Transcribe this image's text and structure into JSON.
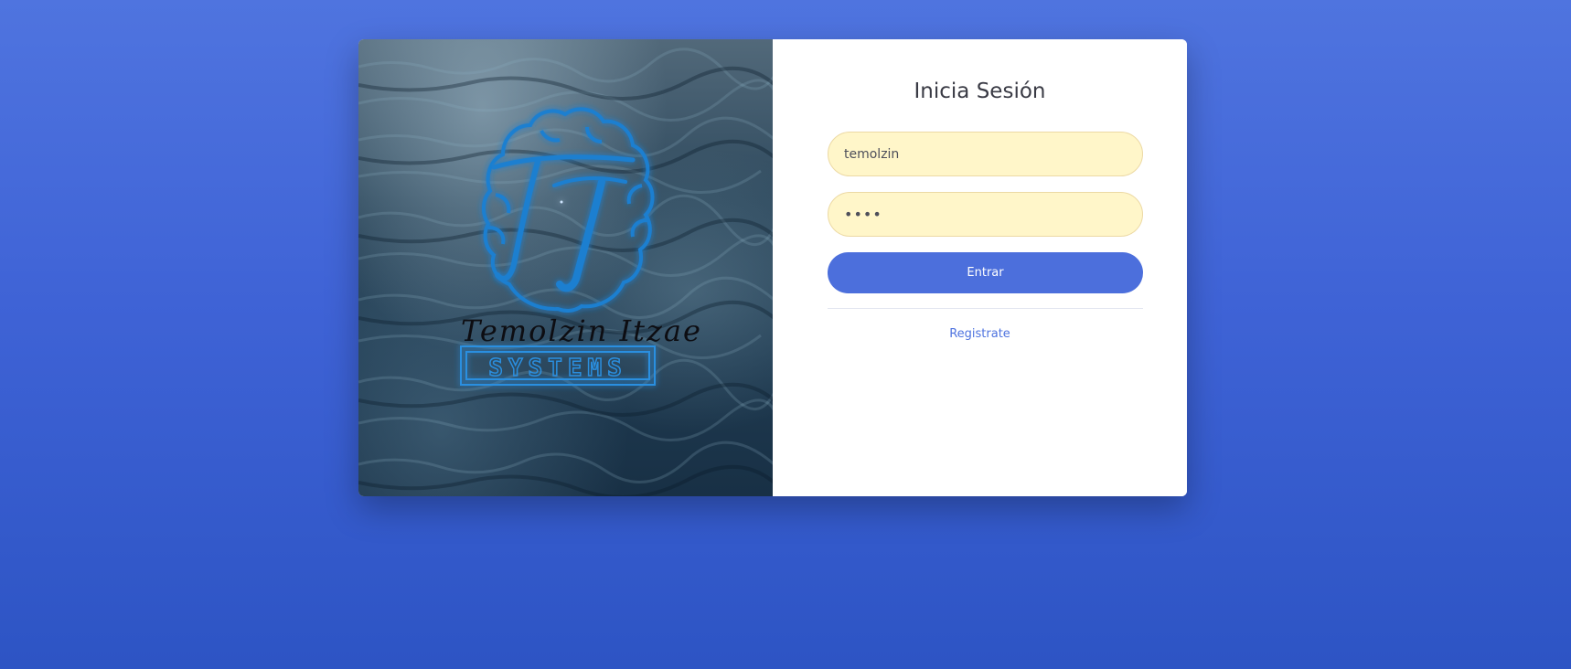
{
  "login": {
    "title": "Inicia Sesión",
    "username_value": "temolzin",
    "password_value": "••••",
    "submit_label": "Entrar",
    "register_label": "Registrate"
  },
  "brand": {
    "logo_line1": "Temolzin Itzae",
    "logo_line2": "SYSTEMS"
  },
  "colors": {
    "background_top": "#4f74df",
    "background_bottom": "#2d54c4",
    "button": "#4c6fdc",
    "input_fill": "#fff6c9",
    "link": "#4e73df",
    "logo": "#1b7fd0"
  }
}
